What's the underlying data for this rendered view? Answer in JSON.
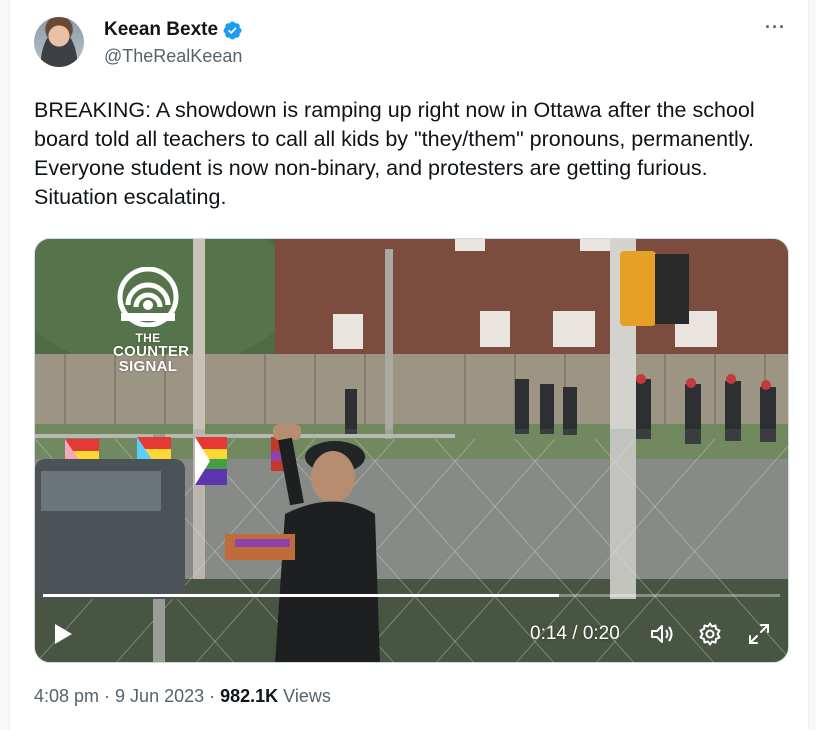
{
  "author": {
    "display_name": "Keean Bexte",
    "handle": "@TheRealKeean",
    "verified": true
  },
  "more_menu": "···",
  "tweet_text": "BREAKING: A showdown is ramping up right now in Ottawa after the school board told all teachers to call all kids by \"they/them\" pronouns, permanently. Everyone student is now non-binary, and protesters are getting furious. Situation escalating.",
  "media": {
    "watermark": [
      "THE",
      "COUNTER",
      "SIGNAL"
    ],
    "time": "0:14 / 0:20",
    "progress": 0.7
  },
  "meta": {
    "time": "4:08 pm",
    "separator": "·",
    "date": "9 Jun 2023",
    "views_count": "982.1K",
    "views_label": "Views"
  },
  "colors": {
    "verified": "#1d9bf0",
    "secondary_text": "#536471",
    "primary_text": "#0f1419"
  }
}
